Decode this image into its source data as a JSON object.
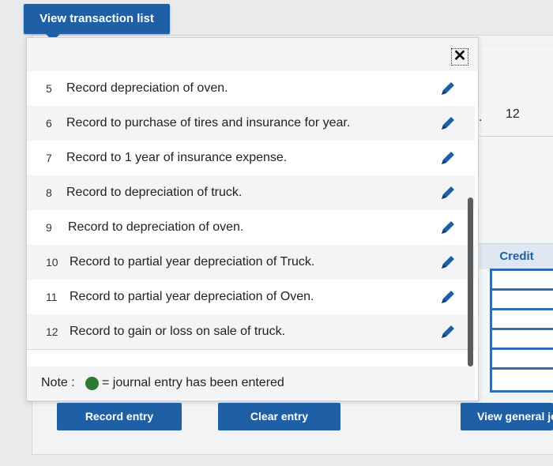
{
  "top_button": {
    "label": "View transaction list"
  },
  "popup": {
    "close_symbol": "✕",
    "rows": [
      {
        "num": "5",
        "label": "Record depreciation of oven."
      },
      {
        "num": "6",
        "label": "Record to purchase of tires and insurance for year."
      },
      {
        "num": "7",
        "label": "Record to 1 year of insurance expense."
      },
      {
        "num": "8",
        "label": "Record to depreciation of truck."
      },
      {
        "num": "9",
        "label": "Record to depreciation of oven."
      },
      {
        "num": "10",
        "label": "Record to partial year depreciation of Truck."
      },
      {
        "num": "11",
        "label": "Record to partial year depreciation of Oven."
      },
      {
        "num": "12",
        "label": "Record to gain or loss on sale of truck."
      }
    ],
    "note": {
      "prefix": "Note :",
      "text": "= journal entry has been entered",
      "dot_color": "#2d7a35"
    },
    "edit_icon": "pencil-icon"
  },
  "background": {
    "dot": ".",
    "number": "12",
    "credit_header": "Credit"
  },
  "buttons": {
    "record": "Record entry",
    "clear": "Clear entry",
    "view_general": "View general jo"
  },
  "colors": {
    "accent": "#1f5fa6",
    "note_dot": "#2d7a35"
  }
}
